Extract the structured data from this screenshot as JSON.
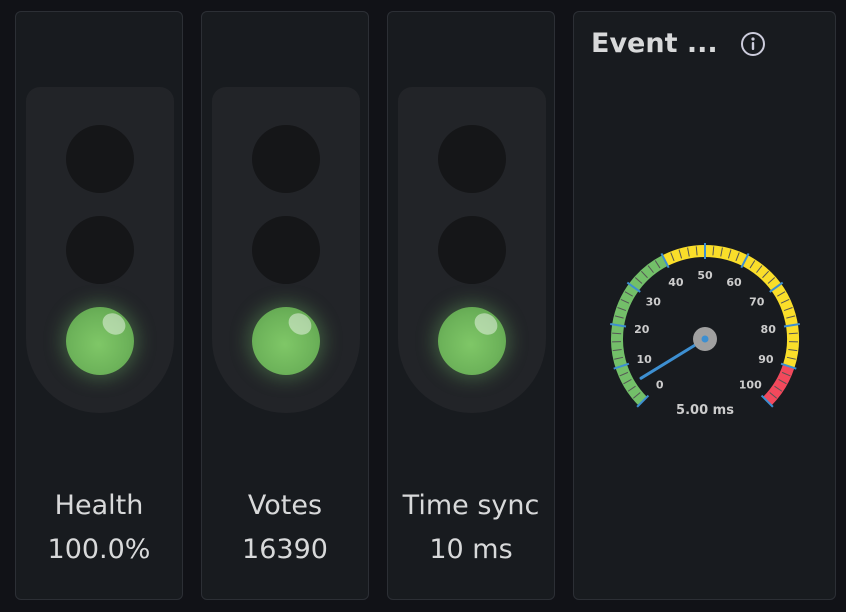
{
  "panels": [
    {
      "label": "Health",
      "value": "100.0%",
      "active_light": "green"
    },
    {
      "label": "Votes",
      "value": "16390",
      "active_light": "green"
    },
    {
      "label": "Time sync",
      "value": "10 ms",
      "active_light": "green"
    }
  ],
  "gauge": {
    "title": "Event ...",
    "info_icon": "info-icon",
    "value": 5,
    "value_text": "5.00 ms",
    "min": 0,
    "max": 100,
    "ticks": [
      "0",
      "10",
      "20",
      "30",
      "40",
      "50",
      "60",
      "70",
      "80",
      "90",
      "100"
    ],
    "bands": [
      {
        "from": 0,
        "to": 40,
        "color": "#73bf69"
      },
      {
        "from": 40,
        "to": 90,
        "color": "#fade2a"
      },
      {
        "from": 90,
        "to": 100,
        "color": "#f2495c"
      }
    ],
    "needle_color": "#3d8fd1",
    "tick_color": "#3d8fd1"
  }
}
